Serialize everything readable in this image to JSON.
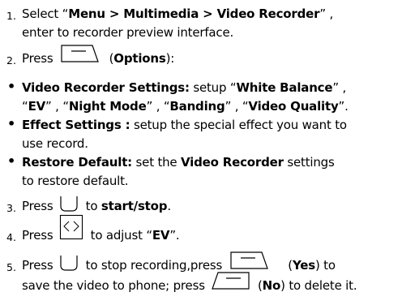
{
  "items": {
    "s1_num": "1.",
    "s1_a": "Select “",
    "s1_b": "Menu > Multimedia > Video Recorder",
    "s1_c": "” ,",
    "s1_line2": "enter to recorder preview interface.",
    "s2_num": "2.",
    "s2_a": "Press",
    "s2_b": "(",
    "s2_c": "Options",
    "s2_d": "):",
    "b1_bold": "Video Recorder Settings:",
    "b1_a": " setup “",
    "b1_wb": "White Balance",
    "b1_b": "” ,",
    "b1_l2_a": "“",
    "b1_ev": "EV",
    "b1_l2_b": "” , “",
    "b1_nm": "Night Mode",
    "b1_l2_c": "” , “",
    "b1_band": "Banding",
    "b1_l2_d": "” , “",
    "b1_vq": "Video Quality",
    "b1_l2_e": "”.",
    "b2_bold": "Effect Settings :",
    "b2_a": " setup the special effect you want to",
    "b2_line2": "use record.",
    "b3_bold": "Restore Default:",
    "b3_a": " set the ",
    "b3_vr": "Video Recorder",
    "b3_b": " settings",
    "b3_line2": "to restore default.",
    "s3_num": "3.",
    "s3_a": "Press",
    "s3_b": "to",
    "s3_c": "start/stop",
    "s3_d": ".",
    "s4_num": "4.",
    "s4_a": "Press",
    "s4_b": "to adjust “",
    "s4_c": "EV",
    "s4_d": "”.",
    "s5_num": "5.",
    "s5_a": "Press",
    "s5_b": "to stop recording,press",
    "s5_c": "(",
    "s5_yes": "Yes",
    "s5_d": ") to",
    "s5_l2_a": "save the video to phone; press",
    "s5_l2_b": "(",
    "s5_no": "No",
    "s5_l2_c": ") to delete it."
  },
  "bullet_char": "•",
  "icons": [
    "left-softkey-icon",
    "ok-key-icon",
    "nav-left-right-icon",
    "right-softkey-icon"
  ]
}
